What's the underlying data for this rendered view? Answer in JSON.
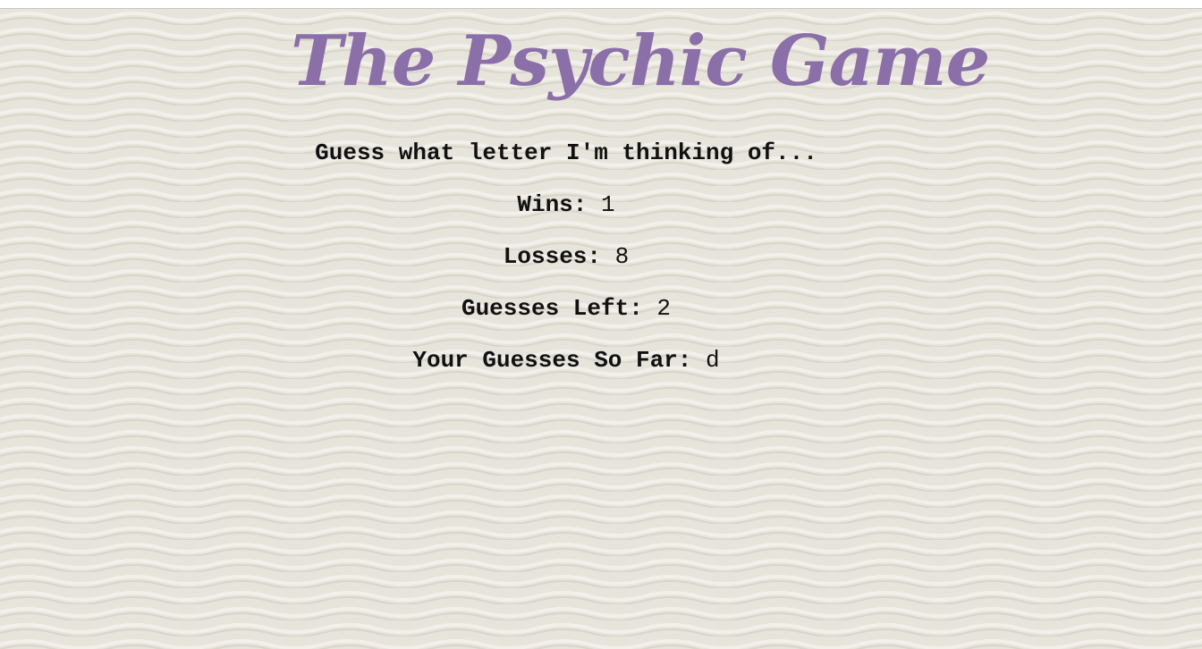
{
  "game": {
    "title": "The Psychic Game",
    "instruction": "Guess what letter I'm thinking of...",
    "wins_label": "Wins:",
    "wins_value": "1",
    "losses_label": "Losses:",
    "losses_value": "8",
    "guesses_left_label": "Guesses Left:",
    "guesses_left_value": "2",
    "guesses_so_far_label": "Your Guesses So Far:",
    "guesses_so_far_value": "d"
  },
  "colors": {
    "title": "#8a6fa8",
    "text": "#111111",
    "background": "#e7e4db"
  }
}
